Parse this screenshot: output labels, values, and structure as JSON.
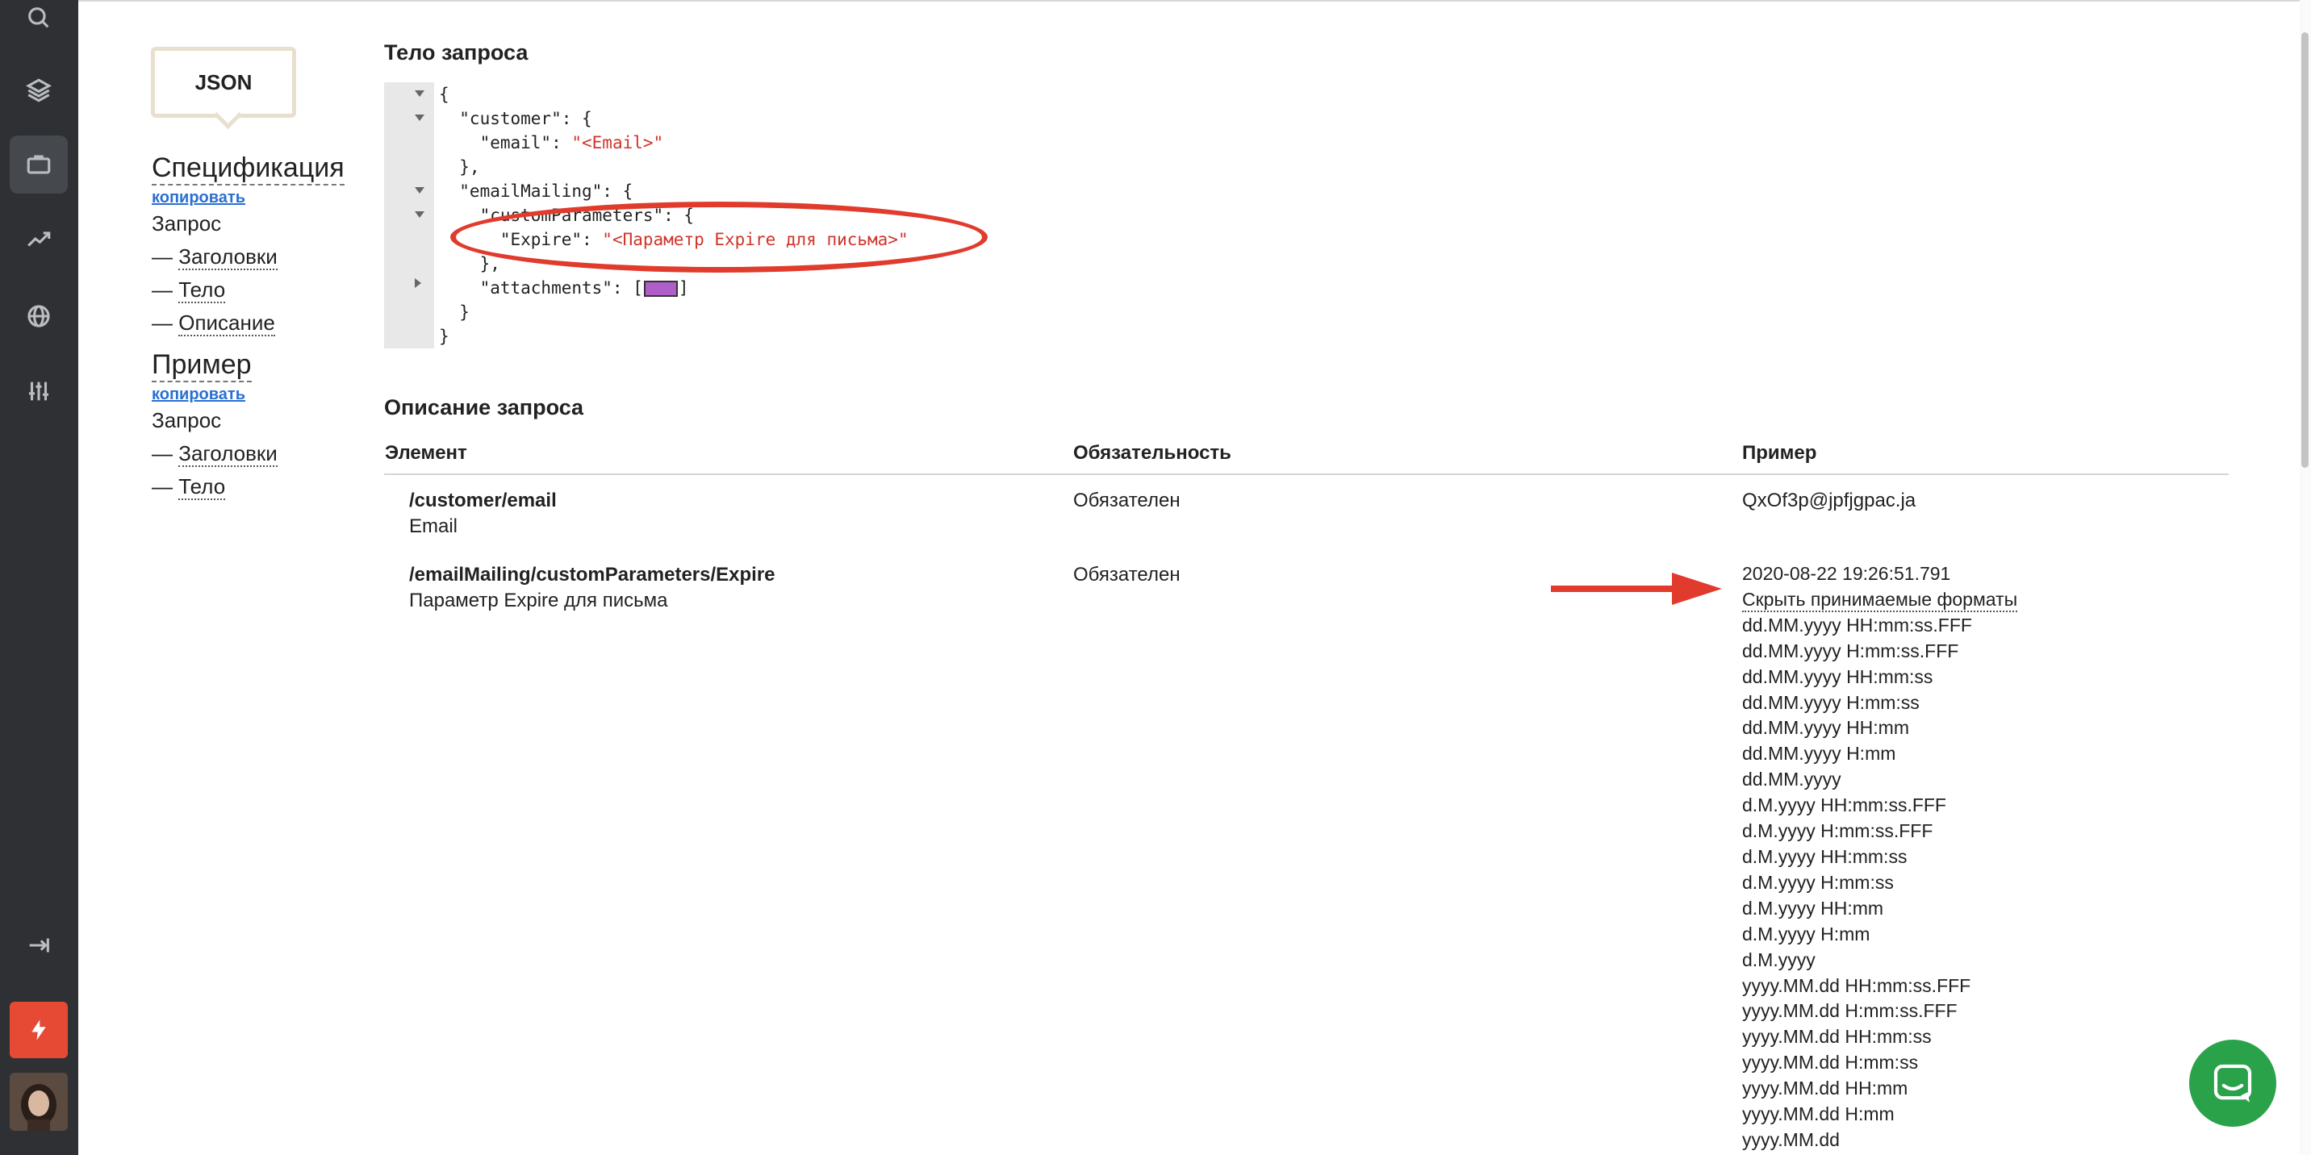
{
  "nav": {
    "badge": "JSON",
    "spec": {
      "heading": "Спецификация",
      "copy": "копировать",
      "request": "Запрос",
      "items": [
        "Заголовки",
        "Тело",
        "Описание"
      ]
    },
    "example": {
      "heading": "Пример",
      "copy": "копировать",
      "request": "Запрос",
      "items": [
        "Заголовки",
        "Тело"
      ]
    },
    "dash": "—"
  },
  "body_section": {
    "title": "Тело запроса",
    "code": {
      "l1": "{",
      "l2_key": "  \"customer\": {",
      "l3_key": "    \"email\": ",
      "l3_val": "\"<Email>\"",
      "l4": "  },",
      "l5": "  \"emailMailing\": {",
      "l6": "    \"customParameters\": {",
      "l7_key": "      \"Expire\": ",
      "l7_val": "\"<Параметр Expire для письма>\"",
      "l8": "    },",
      "l9_a": "    \"attachments\": [",
      "l9_b": "]",
      "l10": "  }",
      "l11": "}"
    }
  },
  "description": {
    "title": "Описание запроса",
    "columns": [
      "Элемент",
      "Обязательность",
      "Пример"
    ],
    "rows": [
      {
        "path": "/customer/email",
        "desc": "Email",
        "required": "Обязателен",
        "example": "QxOf3p@jpfjgpac.ja"
      },
      {
        "path": "/emailMailing/customParameters/Expire",
        "desc": "Параметр Expire для письма",
        "required": "Обязателен",
        "example": "2020-08-22 19:26:51.791"
      }
    ],
    "toggle": "Скрыть принимаемые форматы",
    "formats": [
      "dd.MM.yyyy HH:mm:ss.FFF",
      "dd.MM.yyyy H:mm:ss.FFF",
      "dd.MM.yyyy HH:mm:ss",
      "dd.MM.yyyy H:mm:ss",
      "dd.MM.yyyy HH:mm",
      "dd.MM.yyyy H:mm",
      "dd.MM.yyyy",
      "d.M.yyyy HH:mm:ss.FFF",
      "d.M.yyyy H:mm:ss.FFF",
      "d.M.yyyy HH:mm:ss",
      "d.M.yyyy H:mm:ss",
      "d.M.yyyy HH:mm",
      "d.M.yyyy H:mm",
      "d.M.yyyy",
      "yyyy.MM.dd HH:mm:ss.FFF",
      "yyyy.MM.dd H:mm:ss.FFF",
      "yyyy.MM.dd HH:mm:ss",
      "yyyy.MM.dd H:mm:ss",
      "yyyy.MM.dd HH:mm",
      "yyyy.MM.dd H:mm",
      "yyyy.MM.dd"
    ]
  },
  "icons": {
    "rail": [
      "search-icon",
      "layers-icon",
      "briefcase-icon",
      "trend-icon",
      "globe-icon",
      "sliders-icon",
      "logout-icon",
      "lightning-icon"
    ],
    "chat": "chat-icon"
  },
  "colors": {
    "rail_bg": "#2e3033",
    "accent_red": "#e64a35",
    "link_blue": "#2a6fd1",
    "chat_green": "#2aa24a",
    "annotation_red": "#e03b2c"
  }
}
